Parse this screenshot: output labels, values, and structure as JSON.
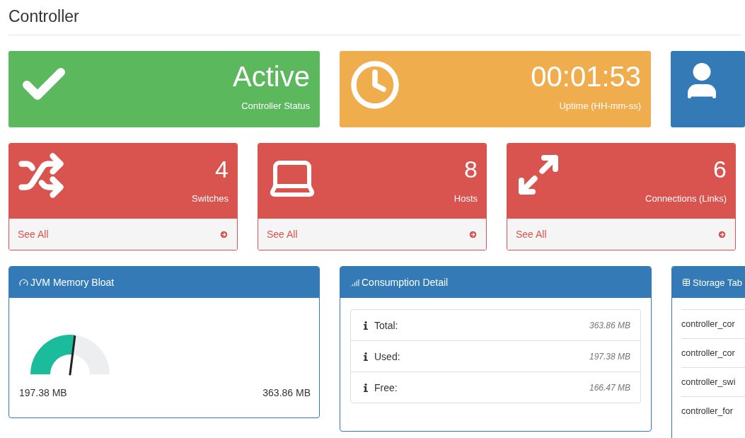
{
  "page_title": "Controller",
  "summary_cards": [
    {
      "kind": "status",
      "value": "Active",
      "label": "Controller Status"
    },
    {
      "kind": "uptime",
      "value": "00:01:53",
      "label": "Uptime (HH-mm-ss)"
    },
    {
      "kind": "user"
    }
  ],
  "count_cards": [
    {
      "kind": "switches",
      "count": "4",
      "label": "Switches",
      "link": "See All"
    },
    {
      "kind": "hosts",
      "count": "8",
      "label": "Hosts",
      "link": "See All"
    },
    {
      "kind": "links",
      "count": "6",
      "label": "Connections (Links)",
      "link": "See All"
    }
  ],
  "memory_panel": {
    "title": "JVM Memory Bloat",
    "level": 0.54,
    "min_label": "197.38 MB",
    "max_label": "363.86 MB"
  },
  "consumption_panel": {
    "title": "Consumption Detail",
    "rows": [
      {
        "label": "Total:",
        "value": "363.86 MB"
      },
      {
        "label": "Used:",
        "value": "197.38 MB"
      },
      {
        "label": "Free:",
        "value": "166.47 MB"
      }
    ]
  },
  "storage_panel": {
    "title": "Storage Tab",
    "rows": [
      "controller_cor",
      "controller_cor",
      "controller_swi",
      "controller_for"
    ]
  }
}
